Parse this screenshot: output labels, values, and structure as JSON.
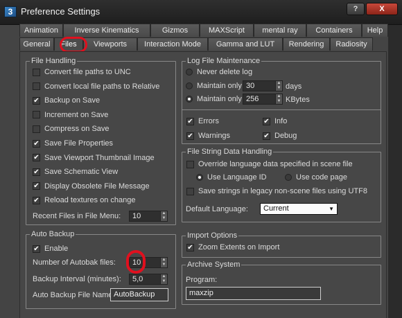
{
  "window": {
    "title": "Preference Settings",
    "help_label": "?",
    "close_label": "X",
    "app_icon": "3"
  },
  "tabs_row1": [
    "Animation",
    "Inverse Kinematics",
    "Gizmos",
    "MAXScript",
    "mental ray",
    "Containers",
    "Help"
  ],
  "tabs_row2": [
    "General",
    "Files",
    "Viewports",
    "Interaction Mode",
    "Gamma and LUT",
    "Rendering",
    "Radiosity"
  ],
  "active_tab": "Files",
  "file_handling": {
    "title": "File Handling",
    "items": [
      {
        "label": "Convert file paths to UNC",
        "checked": false
      },
      {
        "label": "Convert local file paths to Relative",
        "checked": false
      },
      {
        "label": "Backup on Save",
        "checked": true
      },
      {
        "label": "Increment on Save",
        "checked": false
      },
      {
        "label": "Compress on Save",
        "checked": false
      },
      {
        "label": "Save File Properties",
        "checked": true
      },
      {
        "label": "Save Viewport Thumbnail Image",
        "checked": true
      },
      {
        "label": "Save Schematic View",
        "checked": true
      },
      {
        "label": "Display Obsolete File Message",
        "checked": true
      },
      {
        "label": "Reload textures on change",
        "checked": true
      }
    ],
    "recent_label": "Recent Files in File Menu:",
    "recent_value": "10"
  },
  "auto_backup": {
    "title": "Auto Backup",
    "enable_label": "Enable",
    "enable_checked": true,
    "num_label": "Number of Autobak files:",
    "num_value": "10",
    "interval_label": "Backup Interval (minutes):",
    "interval_value": "5,0",
    "name_label": "Auto Backup File Name:",
    "name_value": "AutoBackup"
  },
  "log_file": {
    "title": "Log File Maintenance",
    "never_delete": "Never delete log",
    "maintain_days_label": "Maintain only",
    "maintain_days_value": "30",
    "days_unit": "days",
    "maintain_kb_label": "Maintain only",
    "maintain_kb_value": "256",
    "kb_unit": "KBytes",
    "selected": "kbytes",
    "errors": "Errors",
    "errors_checked": true,
    "info": "Info",
    "info_checked": true,
    "warnings": "Warnings",
    "warnings_checked": true,
    "debug": "Debug",
    "debug_checked": true
  },
  "file_string": {
    "title": "File String Data Handling",
    "override_label": "Override language data specified in scene file",
    "override_checked": false,
    "use_lang_id": "Use Language ID",
    "use_code_page": "Use code page",
    "selected": "language_id",
    "save_utf8": "Save strings in legacy non-scene files using UTF8",
    "save_utf8_checked": false,
    "default_lang_label": "Default Language:",
    "default_lang_value": "Current"
  },
  "import_options": {
    "title": "Import Options",
    "zoom_label": "Zoom Extents on Import",
    "zoom_checked": true
  },
  "archive": {
    "title": "Archive System",
    "program_label": "Program:",
    "program_value": "maxzip"
  }
}
